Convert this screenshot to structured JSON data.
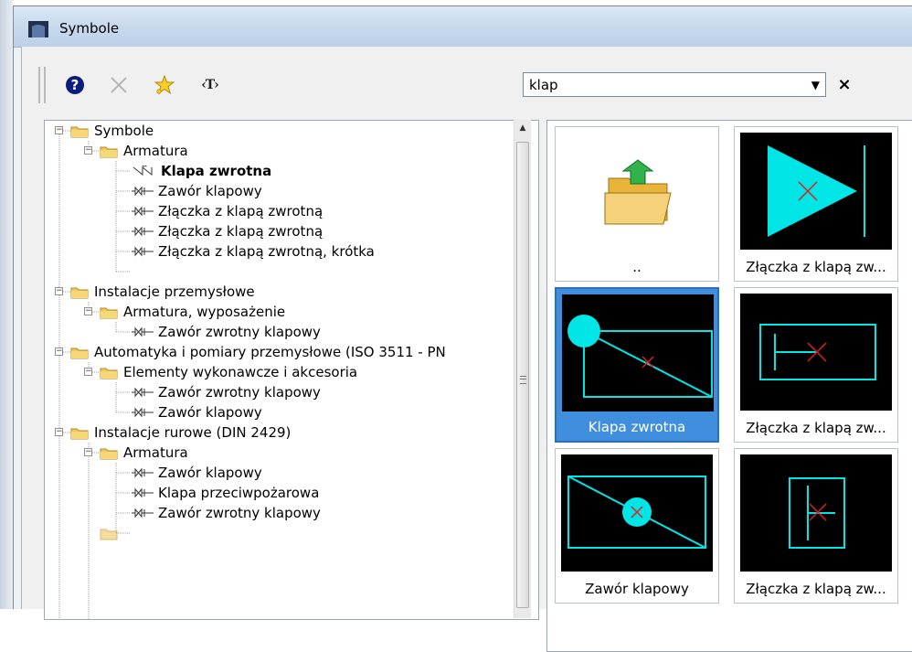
{
  "window": {
    "title": "Symbole"
  },
  "toolbar": {
    "help_icon": "help-icon",
    "delete_icon": "delete-x-icon",
    "favorite_icon": "star-icon",
    "text_icon": "text-toggle-icon",
    "text_icon_glyph": "‹T›"
  },
  "search": {
    "value": "klap",
    "clear_glyph": "×"
  },
  "tree": {
    "nodes": [
      {
        "label": "Symbole",
        "type": "folder"
      },
      {
        "label": "Armatura",
        "type": "folder"
      },
      {
        "label": "Klapa zwrotna",
        "type": "symbol",
        "selected": true
      },
      {
        "label": "Zawór klapowy",
        "type": "symbol"
      },
      {
        "label": "Złączka z klapą zwrotną",
        "type": "symbol"
      },
      {
        "label": "Złączka z klapą zwrotną",
        "type": "symbol"
      },
      {
        "label": "Złączka z klapą zwrotną, krótka",
        "type": "symbol"
      },
      {
        "label": "Instalacje przemysłowe",
        "type": "folder"
      },
      {
        "label": "Armatura, wyposażenie",
        "type": "folder"
      },
      {
        "label": "Zawór zwrotny klapowy",
        "type": "symbol"
      },
      {
        "label": "Automatyka i pomiary przemysłowe (ISO 3511 - PN",
        "type": "folder"
      },
      {
        "label": "Elementy wykonawcze i akcesoria",
        "type": "folder"
      },
      {
        "label": "Zawór zwrotny klapowy",
        "type": "symbol"
      },
      {
        "label": "Zawór klapowy",
        "type": "symbol"
      },
      {
        "label": "Instalacje rurowe (DIN 2429)",
        "type": "folder"
      },
      {
        "label": "Armatura",
        "type": "folder"
      },
      {
        "label": "Zawór klapowy",
        "type": "symbol"
      },
      {
        "label": "Klapa przeciwpożarowa",
        "type": "symbol"
      },
      {
        "label": "Zawór zwrotny klapowy",
        "type": "symbol"
      }
    ]
  },
  "grid": {
    "tiles": [
      {
        "caption": "..",
        "preview": "folder-up-icon"
      },
      {
        "caption": "Złączka z klapą zw...",
        "preview": "triangle-check-valve"
      },
      {
        "caption": "Klapa zwrotna",
        "preview": "circle-flap-valve",
        "selected": true
      },
      {
        "caption": "Złączka z klapą zw...",
        "preview": "bar-flap-valve"
      },
      {
        "caption": "Zawór klapowy",
        "preview": "butterfly-valve"
      },
      {
        "caption": "Złączka z klapą zw...",
        "preview": "vertical-flap-valve"
      }
    ]
  },
  "colors": {
    "symbol_stroke": "#00e5e5",
    "symbol_fill": "#00e5e5",
    "symbol_cross": "#e02020",
    "selection": "#3f8fde"
  }
}
